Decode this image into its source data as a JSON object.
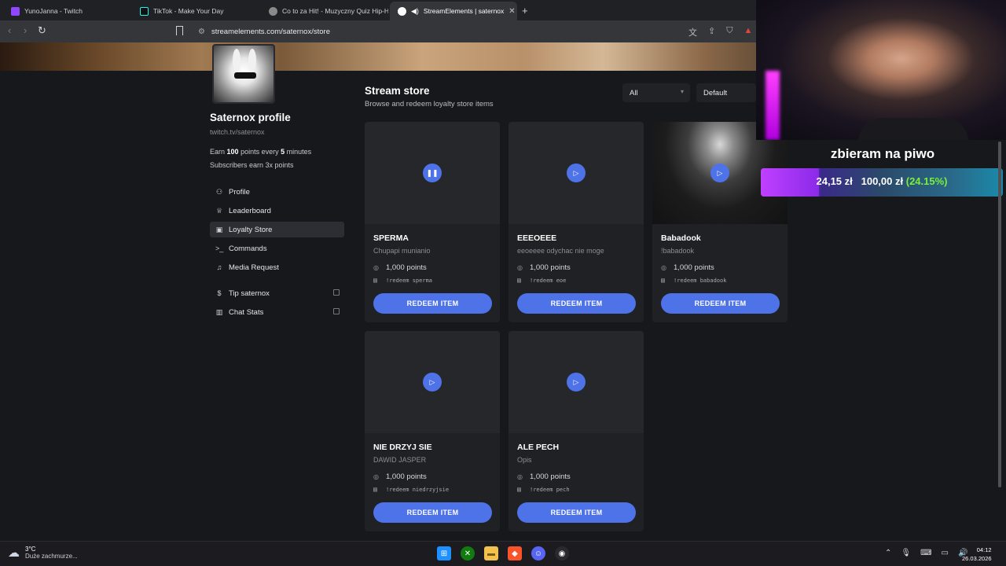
{
  "browser": {
    "tabs": [
      {
        "title": "YunoJanna - Twitch",
        "active": false
      },
      {
        "title": "TikTok - Make Your Day",
        "active": false
      },
      {
        "title": "Co to za Hit! - Muzyczny Quiz Hip-Ho",
        "active": false
      },
      {
        "title": "StreamElements | saternox",
        "active": true
      }
    ],
    "url": "streamelements.com/saternox/store"
  },
  "profile": {
    "title": "Saternox profile",
    "channel": "twitch.tv/saternox",
    "earn_prefix": "Earn",
    "earn_points": "100",
    "earn_mid": "points every",
    "earn_minutes": "5",
    "earn_suffix": "minutes",
    "subscribers": "Subscribers earn 3x points"
  },
  "nav": {
    "items": [
      {
        "label": "Profile",
        "icon": "user-icon"
      },
      {
        "label": "Leaderboard",
        "icon": "trophy-icon"
      },
      {
        "label": "Loyalty Store",
        "icon": "store-icon",
        "active": true
      },
      {
        "label": "Commands",
        "icon": "terminal-icon"
      },
      {
        "label": "Media Request",
        "icon": "music-icon"
      }
    ],
    "external": [
      {
        "label": "Tip saternox",
        "icon": "dollar-icon"
      },
      {
        "label": "Chat Stats",
        "icon": "chart-icon"
      }
    ]
  },
  "store": {
    "title": "Stream store",
    "subtitle": "Browse and redeem loyalty store items",
    "filter": "All",
    "sort": "Default",
    "redeem_label": "REDEEM ITEM",
    "items": [
      {
        "name": "SPERMA",
        "description": "Chupapi munianio",
        "points": "1,000 points",
        "command": "!redeem sperma",
        "media_state": "paused"
      },
      {
        "name": "EEEOEEE",
        "description": "eeoeeee odychac nie moge",
        "points": "1,000 points",
        "command": "!redeem eoe",
        "media_state": "play"
      },
      {
        "name": "Babadook",
        "description": "!babadook",
        "points": "1,000 points",
        "command": "!redeem babadook",
        "media_state": "play"
      },
      {
        "name": "NIE DRZYJ SIE",
        "description": "DAWID JASPER",
        "points": "1,000 points",
        "command": "!redeem niedrzyjsie",
        "media_state": "play"
      },
      {
        "name": "ALE PECH",
        "description": "Opis",
        "points": "1,000 points",
        "command": "!redeem pech",
        "media_state": "play"
      }
    ]
  },
  "overlay": {
    "donation_title": "zbieram na piwo",
    "current": "24,15 zł",
    "goal": "100,00 zł",
    "percent_label": "(24.15%)",
    "progress_fraction": 0.2415
  },
  "taskbar": {
    "temperature": "3°C",
    "weather": "Duże zachmurze...",
    "time": "04:12",
    "date": "26.03.2026"
  },
  "colors": {
    "accent": "#4e72e8",
    "background": "#16181b",
    "card": "#1f2124",
    "progress_green": "#7af03a"
  }
}
